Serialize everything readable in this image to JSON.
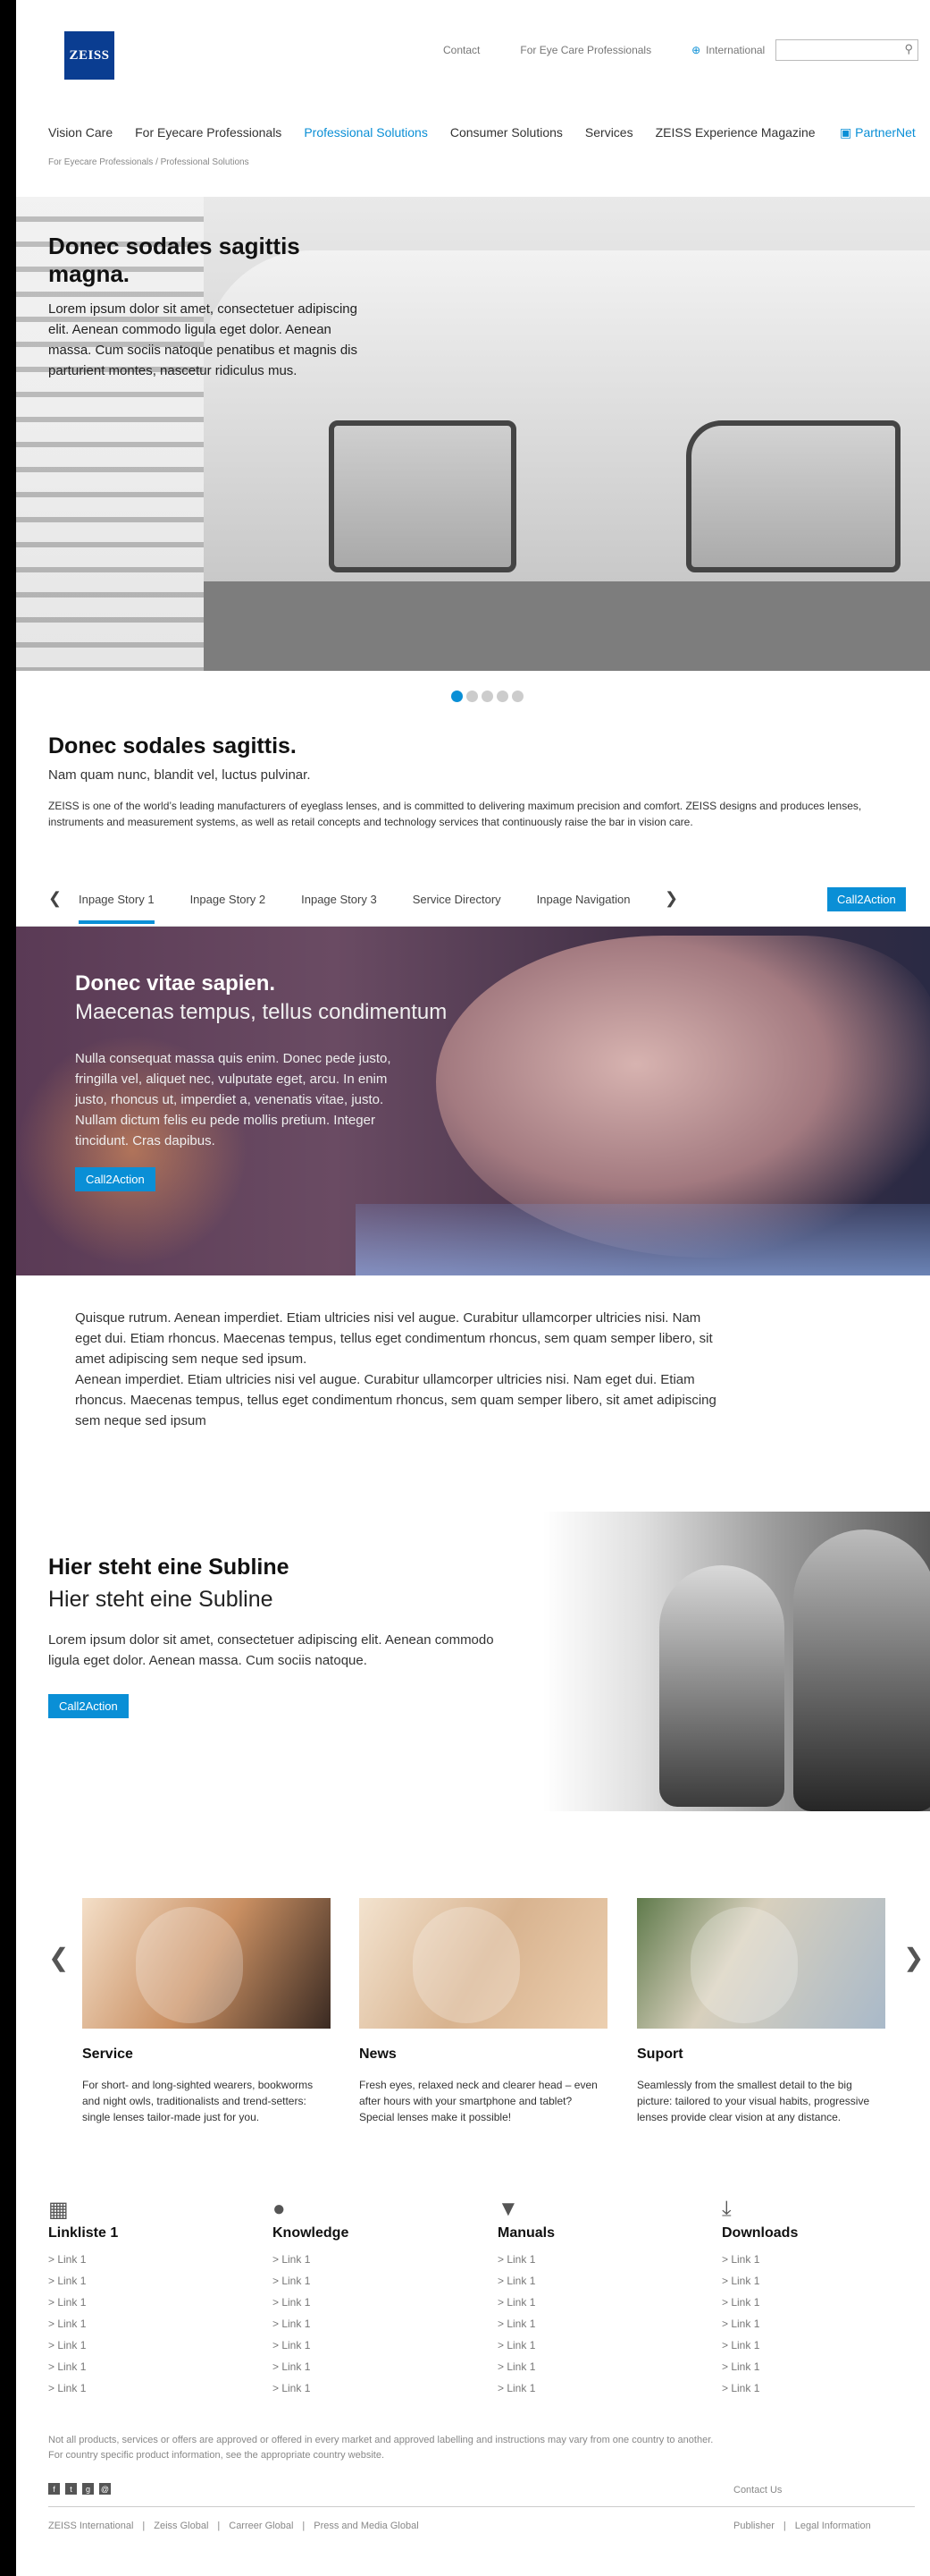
{
  "header": {
    "logo_text": "ZEISS",
    "top_links": [
      "Contact",
      "For Eye Care Professionals",
      "International"
    ],
    "search_placeholder": ""
  },
  "main_nav": {
    "items": [
      "Vision Care",
      "For Eyecare Professionals",
      "Professional Solutions",
      "Consumer Solutions",
      "Services",
      "ZEISS Experience Magazine"
    ],
    "active_index": 2,
    "partner_label": "PartnerNet"
  },
  "breadcrumb": {
    "items": [
      "For Eyecare Professionals",
      "Professional Solutions"
    ],
    "separator": "/"
  },
  "hero": {
    "title": "Donec sodales sagittis magna.",
    "body": "Lorem ipsum dolor sit amet, consectetuer adipiscing elit. Aenean commodo ligula eget dolor. Aenean massa. Cum sociis natoque penatibus et magnis dis parturient montes, nascetur ridiculus mus.",
    "dot_count": 5,
    "active_dot": 0
  },
  "intro": {
    "title": "Donec sodales sagittis.",
    "subtitle": "Nam quam nunc, blandit vel, luctus pulvinar.",
    "body": "ZEISS is one of the world’s leading manufacturers of eyeglass lenses, and is committed to delivering maximum precision and comfort. ZEISS designs and produces lenses, instruments and measurement systems, as well as retail concepts and technology services that continuously raise the bar in vision care."
  },
  "inpage_nav": {
    "prev": "❮",
    "next": "❯",
    "items": [
      "Inpage Story 1",
      "Inpage Story 2",
      "Inpage Story 3",
      "Service Directory",
      "Inpage Navigation"
    ],
    "active_index": 0,
    "cta": "Call2Action"
  },
  "story": {
    "title": "Donec vitae sapien.",
    "subtitle": "Maecenas tempus, tellus condimentum",
    "body": "Nulla consequat massa quis enim. Donec pede justo, fringilla vel, aliquet nec, vulputate eget, arcu. In enim justo, rhoncus ut, imperdiet a, venenatis vitae, justo. Nullam dictum felis eu pede mollis pretium. Integer tincidunt. Cras dapibus.",
    "cta": "Call2Action"
  },
  "quisque": {
    "para1": "Quisque rutrum. Aenean imperdiet. Etiam ultricies nisi vel augue. Curabitur ullamcorper ultricies nisi. Nam eget dui. Etiam rhoncus. Maecenas tempus, tellus eget condimentum rhoncus, sem quam semper libero, sit amet adipiscing sem neque sed ipsum.",
    "para2": "Aenean imperdiet. Etiam ultricies nisi vel augue. Curabitur ullamcorper ultricies nisi. Nam eget dui. Etiam rhoncus. Maecenas tempus, tellus eget condimentum rhoncus, sem quam semper libero, sit amet adipiscing sem neque sed ipsum"
  },
  "subline": {
    "title": "Hier steht eine Subline",
    "subtitle": "Hier steht eine Subline",
    "body": "Lorem ipsum dolor sit amet, consectetuer adipiscing elit. Aenean commodo ligula eget dolor. Aenean massa. Cum sociis natoque.",
    "cta": "Call2Action"
  },
  "teasers": {
    "prev": "❮",
    "next": "❯",
    "items": [
      {
        "title": "Service",
        "text": "For short- and long-sighted wearers, bookworms and night owls, traditionalists and trend-setters: single lenses tailor-made just for you."
      },
      {
        "title": "News",
        "text": "Fresh eyes, relaxed neck and clearer head – even after hours with your smartphone and tablet? Special lenses make it possible!"
      },
      {
        "title": "Suport",
        "text": "Seamlessly from the smallest detail to the big picture: tailored to your visual habits, progressive lenses provide clear vision at any distance."
      }
    ]
  },
  "link_columns": [
    {
      "icon": "grid-icon",
      "title": "Linkliste 1",
      "links": [
        "> Link 1",
        "> Link 1",
        "> Link 1",
        "> Link 1",
        "> Link 1",
        "> Link 1",
        "> Link 1"
      ]
    },
    {
      "icon": "lightbulb-icon",
      "title": "Knowledge",
      "links": [
        "> Link 1",
        "> Link 1",
        "> Link 1",
        "> Link 1",
        "> Link 1",
        "> Link 1",
        "> Link 1"
      ]
    },
    {
      "icon": "book-icon",
      "title": "Manuals",
      "links": [
        "> Link 1",
        "> Link 1",
        "> Link 1",
        "> Link 1",
        "> Link 1",
        "> Link 1",
        "> Link 1"
      ]
    },
    {
      "icon": "download-icon",
      "title": "Downloads",
      "links": [
        "> Link 1",
        "> Link 1",
        "> Link 1",
        "> Link 1",
        "> Link 1",
        "> Link 1",
        "> Link 1"
      ]
    }
  ],
  "footer": {
    "disclaimer1": "Not all products, services or offers are approved or offered in every market and approved labelling and instructions may vary from one country to another.",
    "disclaimer2": "For country specific product information, see the appropriate country website.",
    "social_icons": [
      "facebook-icon",
      "twitter-icon",
      "googleplus-icon",
      "email-icon"
    ],
    "contact_us": "Contact Us",
    "links": [
      "ZEISS International",
      "Zeiss Global",
      "Carreer Global",
      "Press and Media Global"
    ],
    "right_links": [
      "Publisher",
      "Legal Information"
    ],
    "separator": "|"
  },
  "colors": {
    "accent": "#0a8fd6",
    "logo_bg": "#0a3d91"
  }
}
